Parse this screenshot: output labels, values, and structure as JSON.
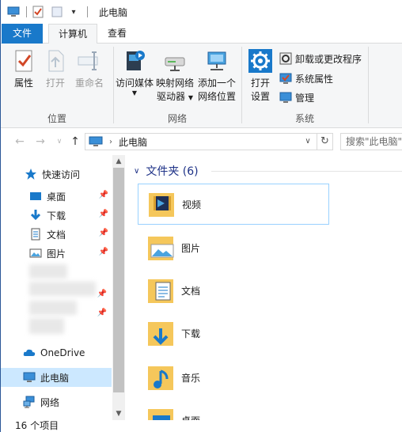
{
  "window": {
    "title": "此电脑",
    "quick_access_dropdown": "▾"
  },
  "tabs": {
    "file": "文件",
    "computer": "计算机",
    "view": "查看"
  },
  "ribbon": {
    "location": {
      "label": "位置",
      "properties": "属性",
      "open": "打开",
      "rename": "重命名"
    },
    "network": {
      "label": "网络",
      "access_media": "访问媒体",
      "map_drive_1": "映射网络",
      "map_drive_2": "驱动器",
      "add_location_1": "添加一个",
      "add_location_2": "网络位置"
    },
    "system": {
      "label": "系统",
      "open_settings_1": "打开",
      "open_settings_2": "设置",
      "uninstall": "卸载或更改程序",
      "system_properties": "系统属性",
      "manage": "管理"
    }
  },
  "address": {
    "path": "此电脑",
    "search_placeholder": "搜索\"此电脑\""
  },
  "nav": {
    "quick_access": "快速访问",
    "desktop": "桌面",
    "downloads": "下载",
    "documents": "文档",
    "pictures": "图片",
    "onedrive": "OneDrive",
    "this_pc": "此电脑",
    "network": "网络"
  },
  "content": {
    "section_title": "文件夹 (6)",
    "folders": [
      "视频",
      "图片",
      "文档",
      "下载",
      "音乐",
      "桌面"
    ]
  },
  "status": {
    "item_count": "16 个项目"
  },
  "colors": {
    "accent": "#1979ca",
    "folder": "#f5c75b",
    "selection": "#cce8ff"
  }
}
